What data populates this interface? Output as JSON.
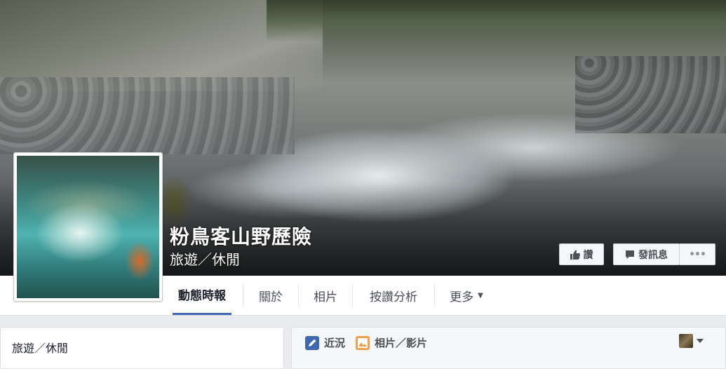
{
  "page": {
    "name": "粉鳥客山野歷險",
    "category": "旅遊／休閒"
  },
  "cover_actions": {
    "like": "讚",
    "message": "發訊息",
    "more": "•••"
  },
  "tabs": [
    {
      "label": "動態時報",
      "active": true
    },
    {
      "label": "關於",
      "active": false
    },
    {
      "label": "相片",
      "active": false
    },
    {
      "label": "按讚分析",
      "active": false
    },
    {
      "label": "更多",
      "active": false
    }
  ],
  "about_card": {
    "category": "旅遊／休閒"
  },
  "composer": {
    "status_label": "近況",
    "photo_label": "相片／影片"
  },
  "colors": {
    "accent": "#4267b2",
    "background": "#e9ebee"
  }
}
